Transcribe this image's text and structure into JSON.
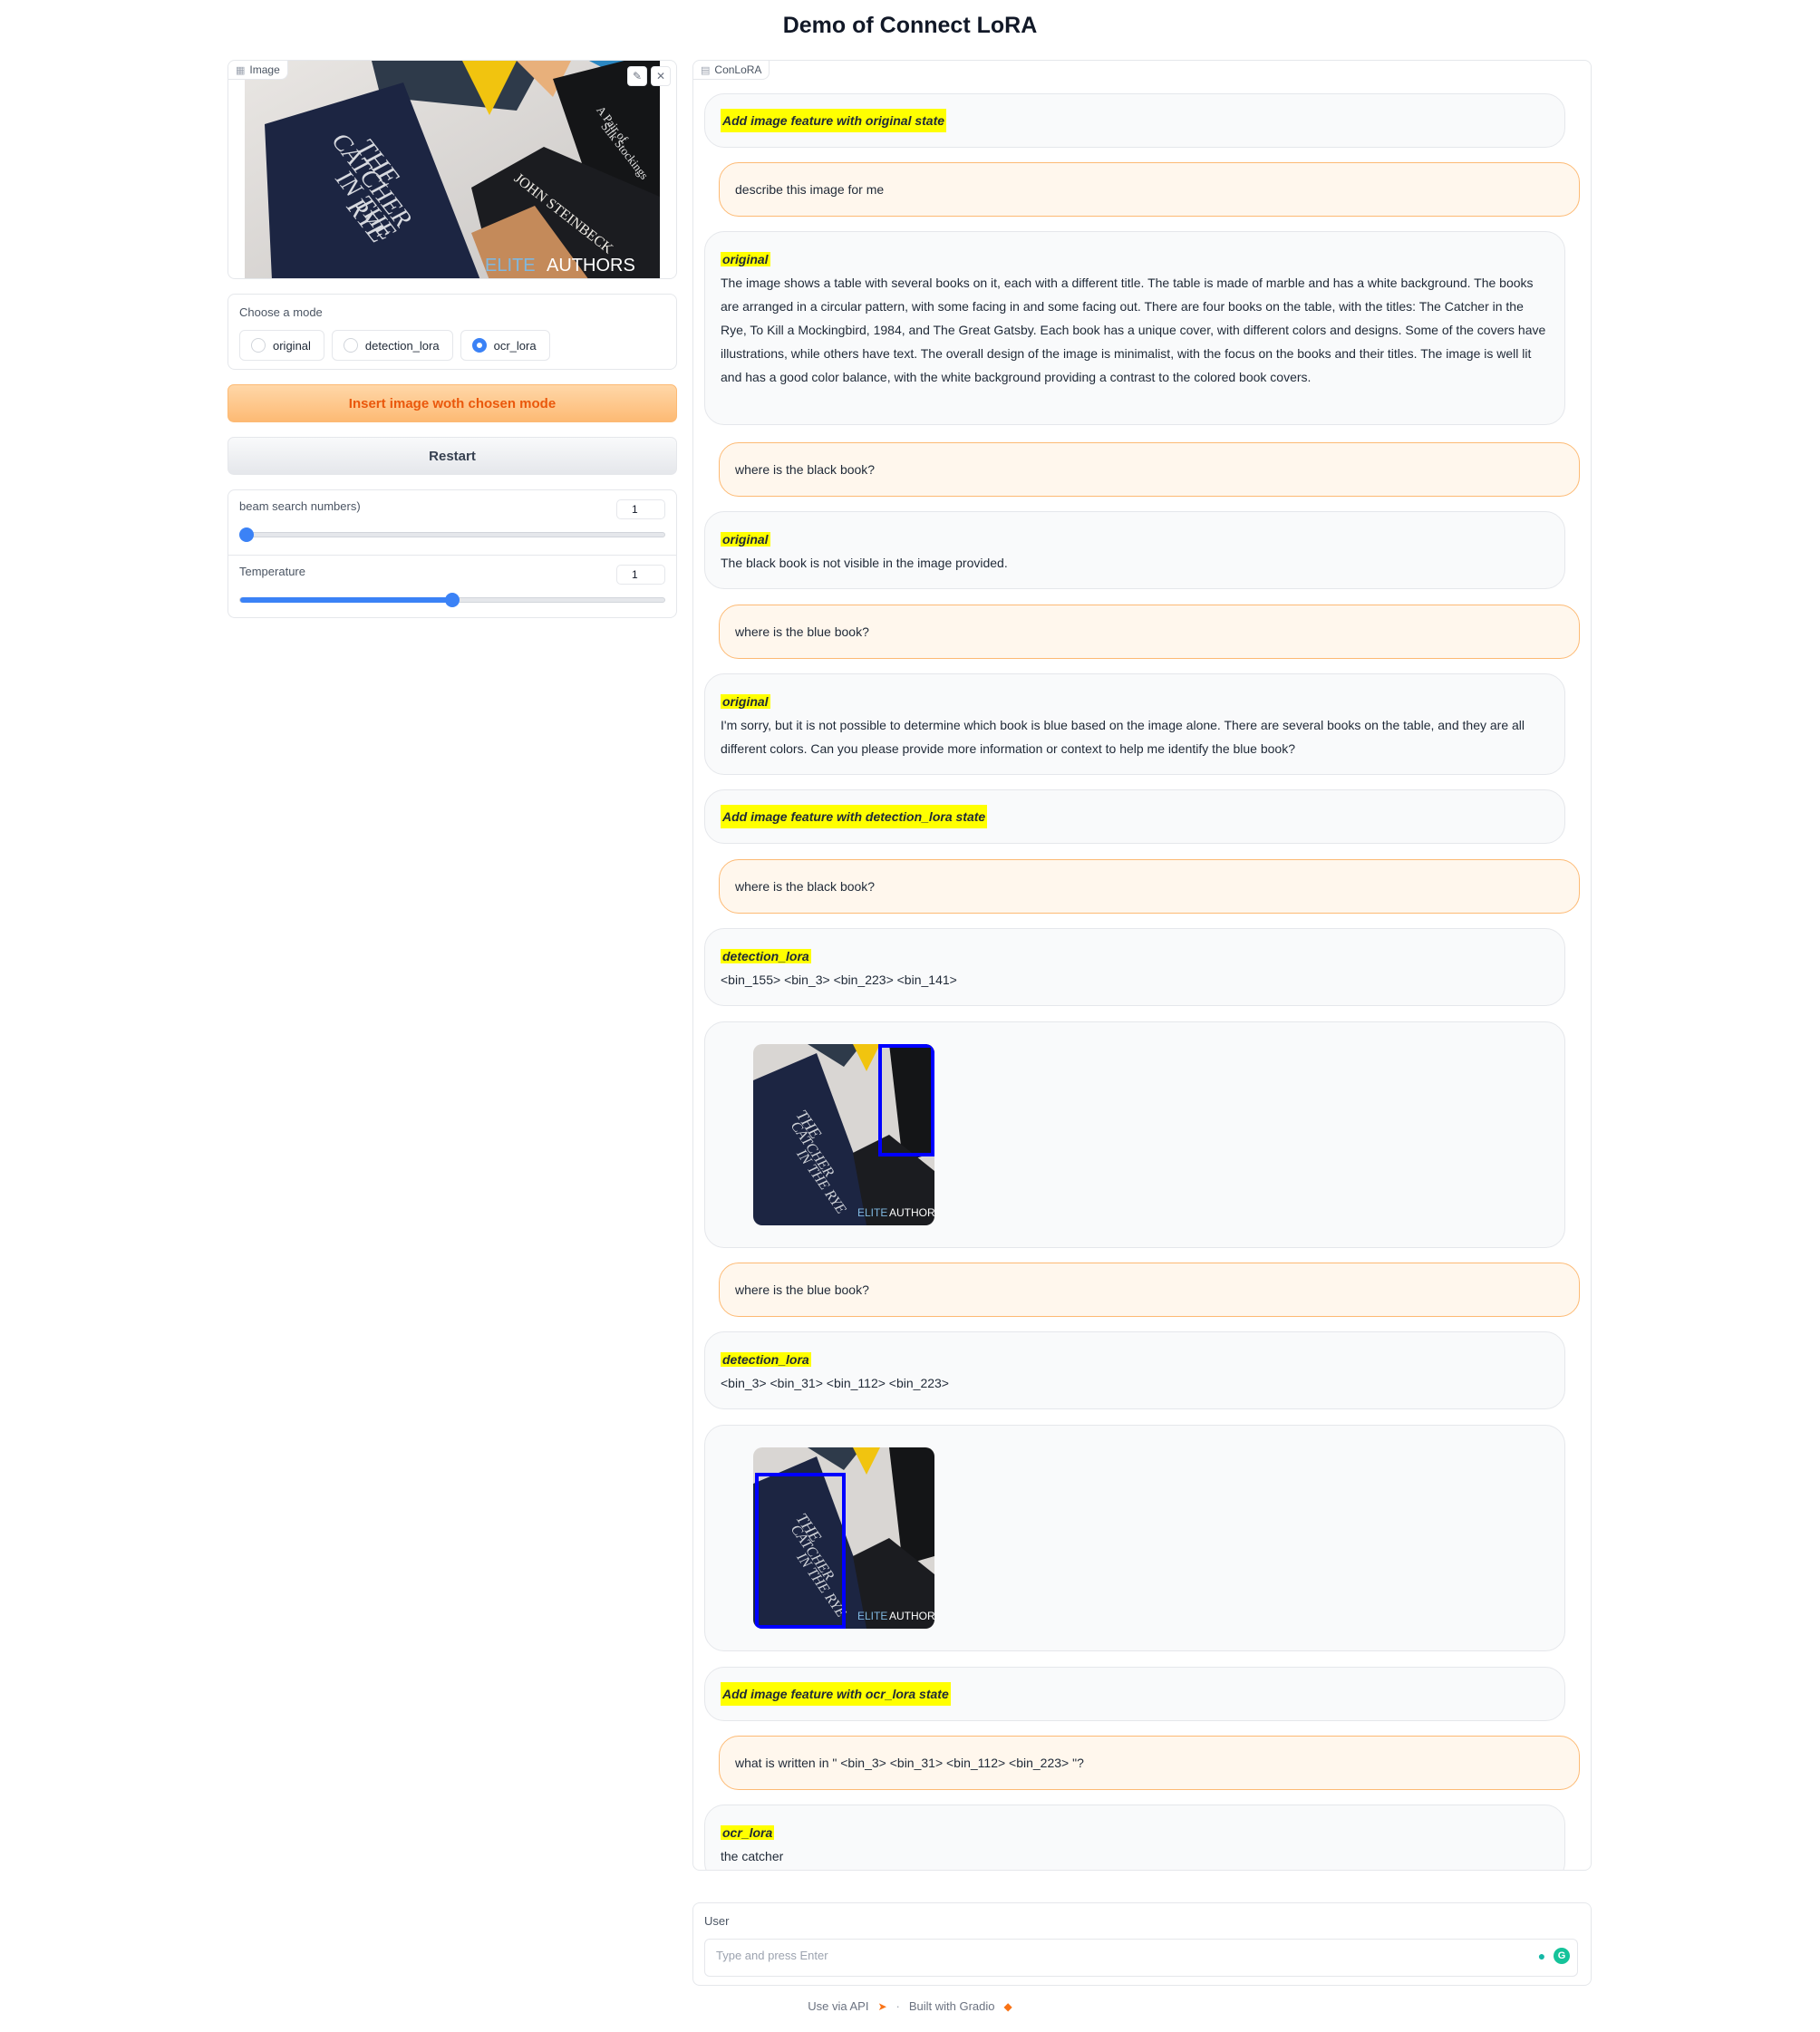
{
  "header": {
    "title": "Demo of Connect LoRA"
  },
  "image_panel": {
    "label": "Image",
    "label_icon": "image-icon",
    "tools": [
      "edit-icon",
      "close-icon"
    ],
    "photo": {
      "watermark_light": "ELITE",
      "watermark_bold": "AUTHORS"
    }
  },
  "mode_selector": {
    "label": "Choose a mode",
    "options": [
      {
        "label": "original",
        "selected": false
      },
      {
        "label": "detection_lora",
        "selected": false
      },
      {
        "label": "ocr_lora",
        "selected": true
      }
    ]
  },
  "buttons": {
    "insert": "Insert image woth chosen mode",
    "restart": "Restart"
  },
  "sliders": [
    {
      "label": "beam search numbers)",
      "value": "1",
      "fraction": 0.0
    },
    {
      "label": "Temperature",
      "value": "1",
      "fraction": 0.5
    }
  ],
  "chat": {
    "label": "ConLoRA",
    "label_icon": "chat-icon",
    "messages": [
      {
        "role": "bot",
        "tag": "Add image feature with original state",
        "text": ""
      },
      {
        "role": "user",
        "text": "describe this image for me"
      },
      {
        "role": "bot",
        "tag": "original",
        "text": "The image shows a table with several books on it, each with a different title. The table is made of marble and has a white background. The books are arranged in a circular pattern, with some facing in and some facing out. There are four books on the table, with the titles: The Catcher in the Rye, To Kill a Mockingbird, 1984, and The Great Gatsby. Each book has a unique cover, with different colors and designs. Some of the covers have illustrations, while others have text. The overall design of the image is minimalist, with the focus on the books and their titles. The image is well lit and has a good color balance, with the white background providing a contrast to the colored book covers."
      },
      {
        "role": "user",
        "text": "where is the black book?"
      },
      {
        "role": "bot",
        "tag": "original",
        "text": "The black book is not visible in the image provided."
      },
      {
        "role": "user",
        "text": "where is the blue book?"
      },
      {
        "role": "bot",
        "tag": "original",
        "text": "I'm sorry, but it is not possible to determine which book is blue based on the image alone. There are several books on the table, and they are all different colors. Can you please provide more information or context to help me identify the blue book?"
      },
      {
        "role": "bot",
        "tag": "Add image feature with detection_lora state",
        "text": ""
      },
      {
        "role": "user",
        "text": "where is the black book?"
      },
      {
        "role": "bot",
        "tag": "detection_lora",
        "text": "<bin_155> <bin_3> <bin_223> <bin_141>"
      },
      {
        "role": "bot",
        "type": "image",
        "box_color": "#0000ff",
        "box": "right"
      },
      {
        "role": "user",
        "text": "where is the blue book?"
      },
      {
        "role": "bot",
        "tag": "detection_lora",
        "text": "<bin_3> <bin_31> <bin_112> <bin_223>"
      },
      {
        "role": "bot",
        "type": "image",
        "box_color": "#0000ff",
        "box": "left"
      },
      {
        "role": "bot",
        "tag": "Add image feature with ocr_lora state",
        "text": ""
      },
      {
        "role": "user",
        "text": "what is written in \" <bin_3> <bin_31> <bin_112> <bin_223> \"?"
      },
      {
        "role": "bot",
        "tag": "ocr_lora",
        "text": "the catcher"
      }
    ]
  },
  "input": {
    "label": "User",
    "placeholder": "Type and press Enter",
    "icons": [
      "bulb-icon",
      "grammarly-icon"
    ]
  },
  "footer": {
    "api": "Use via API",
    "separator": "·",
    "built": "Built with Gradio"
  },
  "colors": {
    "accent": "#3b82f6",
    "user_bubble": "#fff7ed",
    "user_border": "#fdba74",
    "highlight": "#ffff00",
    "box": "#0000ff"
  }
}
